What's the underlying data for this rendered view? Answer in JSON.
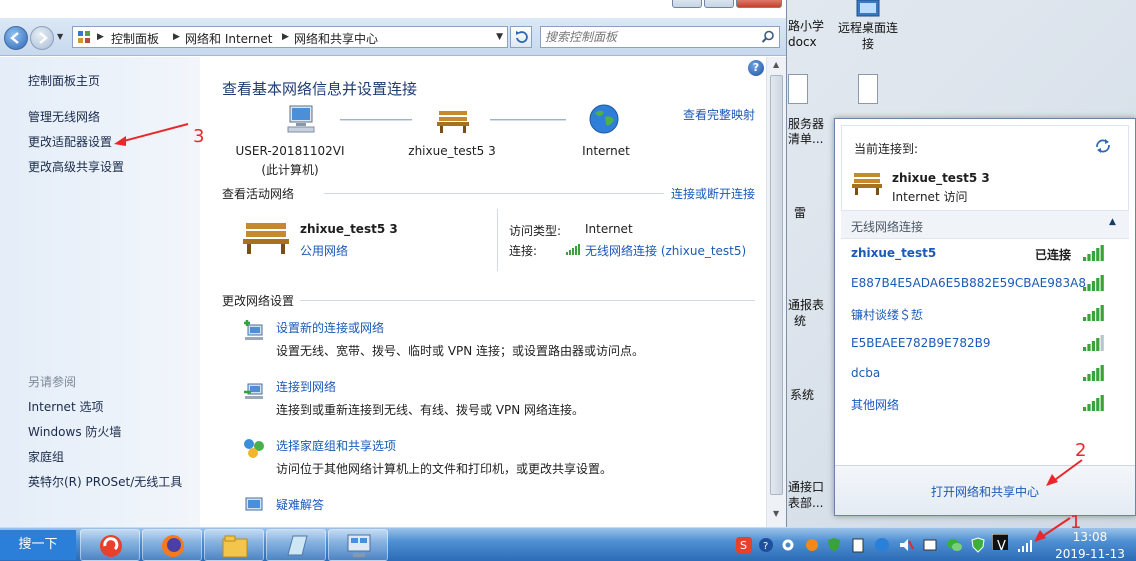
{
  "desktop": {
    "icons": [
      {
        "label": "远程桌面连接"
      },
      {
        "label": "路小学"
      },
      {
        "label": "docx"
      }
    ],
    "partial_texts": [
      "服务器",
      "清单...",
      "雷",
      "通报表",
      "统",
      "系统",
      "通接口",
      "表部..."
    ]
  },
  "explorer": {
    "breadcrumb": [
      "控制面板",
      "网络和 Internet",
      "网络和共享中心"
    ],
    "search_placeholder": "搜索控制面板",
    "leftnav": {
      "home": "控制面板主页",
      "items": [
        "管理无线网络",
        "更改适配器设置",
        "更改高级共享设置"
      ],
      "see_also_title": "另请参阅",
      "see_also": [
        "Internet 选项",
        "Windows 防火墙",
        "家庭组",
        "英特尔(R) PROSet/无线工具"
      ]
    },
    "main": {
      "title": "查看基本网络信息并设置连接",
      "full_map_link": "查看完整映射",
      "map": {
        "computer": "USER-20181102VI",
        "computer_sub": "(此计算机)",
        "network": "zhixue_test5  3",
        "internet": "Internet"
      },
      "active_title": "查看活动网络",
      "connect_link": "连接或断开连接",
      "active": {
        "name": "zhixue_test5  3",
        "type_link": "公用网络",
        "access_label": "访问类型:",
        "access_value": "Internet",
        "conn_label": "连接:",
        "conn_value": "无线网络连接 (zhixue_test5)"
      },
      "change_title": "更改网络设置",
      "tasks": [
        {
          "link": "设置新的连接或网络",
          "desc": "设置无线、宽带、拨号、临时或 VPN 连接；或设置路由器或访问点。"
        },
        {
          "link": "连接到网络",
          "desc": "连接到或重新连接到无线、有线、拨号或 VPN 网络连接。"
        },
        {
          "link": "选择家庭组和共享选项",
          "desc": "访问位于其他网络计算机上的文件和打印机，或更改共享设置。"
        },
        {
          "link": "疑难解答",
          "desc": ""
        }
      ]
    }
  },
  "flyout": {
    "current_label": "当前连接到:",
    "current_name": "zhixue_test5  3",
    "current_access": "Internet 访问",
    "section_title": "无线网络连接",
    "connected_label": "已连接",
    "networks": [
      {
        "name": "zhixue_test5",
        "signal": 5
      },
      {
        "name": "E887B4E5ADA6E5B882E59CBAE983A8",
        "signal": 5
      },
      {
        "name": "镰村谈缕＄悊",
        "signal": 5
      },
      {
        "name": "E5BEAEE782B9E782B9",
        "signal": 4
      },
      {
        "name": "dcba",
        "signal": 5
      },
      {
        "name": "其他网络",
        "signal": 5
      }
    ],
    "open_center": "打开网络和共享中心"
  },
  "taskbar": {
    "search_button": "搜一下",
    "time": "13:08",
    "date": "2019-11-13"
  },
  "annotations": [
    "1",
    "2",
    "3"
  ],
  "colors": {
    "link": "#1a5ab8",
    "title": "#1e3d74",
    "annotation": "#e8272a",
    "taskbar": "#2c6cb8"
  }
}
